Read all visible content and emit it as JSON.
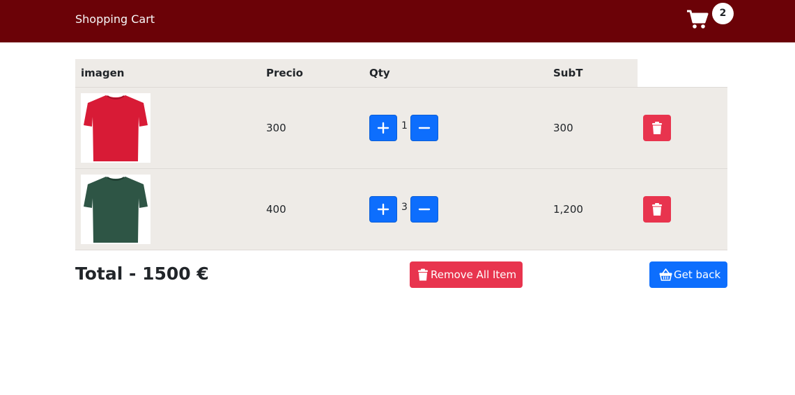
{
  "navbar": {
    "brand": "Shopping Cart",
    "cart_icon": "shopping-cart-icon",
    "cart_count": "2",
    "background": "#6b0207"
  },
  "table": {
    "headers": {
      "image": "imagen",
      "price": "Precio",
      "qty": "Qty",
      "subtotal": "SubT"
    },
    "rows": [
      {
        "image": "red t-shirt",
        "price": "300",
        "qty": "1",
        "subtotal": "300"
      },
      {
        "image": "green t-shirt",
        "price": "400",
        "qty": "3",
        "subtotal": "1,200"
      }
    ]
  },
  "footer": {
    "total": "Total - 1500 €",
    "remove_all_label": "Remove All Item",
    "remove_all_icon": "trash-icon",
    "get_back_label": "Get back",
    "get_back_icon": "basket-icon"
  },
  "colors": {
    "primary": "#0d6efd",
    "danger": "#e8344e",
    "table_bg": "#eeebe7"
  }
}
